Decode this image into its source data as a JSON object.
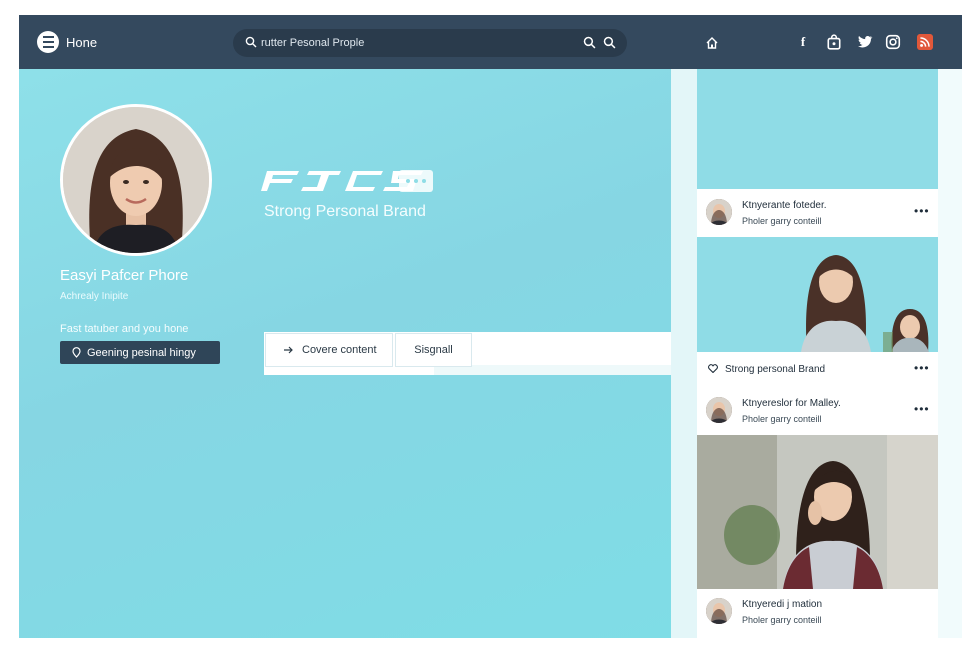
{
  "colors": {
    "topbar": "#34495e",
    "accent": "#8fdde6",
    "button_dark": "#2f4558",
    "rss": "#e1583a"
  },
  "topbar": {
    "home_label": "Hone",
    "search_value": "rutter Pesonal Prople",
    "icons": [
      "menu-icon",
      "search-icon",
      "home-icon",
      "facebook-icon",
      "bag-icon",
      "twitter-icon",
      "instagram-icon",
      "rss-icon"
    ]
  },
  "hero": {
    "logo_text": "FJCS",
    "tagline": "Strong Personal Brand",
    "profile_name": "Easyi Pafcer Phore",
    "profile_subtitle": "Achrealy Inipite",
    "profile_tag": "Fast tatuber and you hone",
    "profile_button": "Geening pesinal hingy",
    "cover_button": "Covere content",
    "signal_button": "Sisgnall"
  },
  "feed": {
    "posts": [
      {
        "title": "Ktnyerante foteder.",
        "subtitle": "Pholer garry conteill"
      },
      {
        "title": "Ktnyereslor for Malley.",
        "subtitle": "Pholer garry conteill"
      },
      {
        "title": "Ktnyeredi j mation",
        "subtitle": "Pholer garry conteill"
      }
    ],
    "caption": "Strong personal Brand",
    "more_label": "•••"
  }
}
